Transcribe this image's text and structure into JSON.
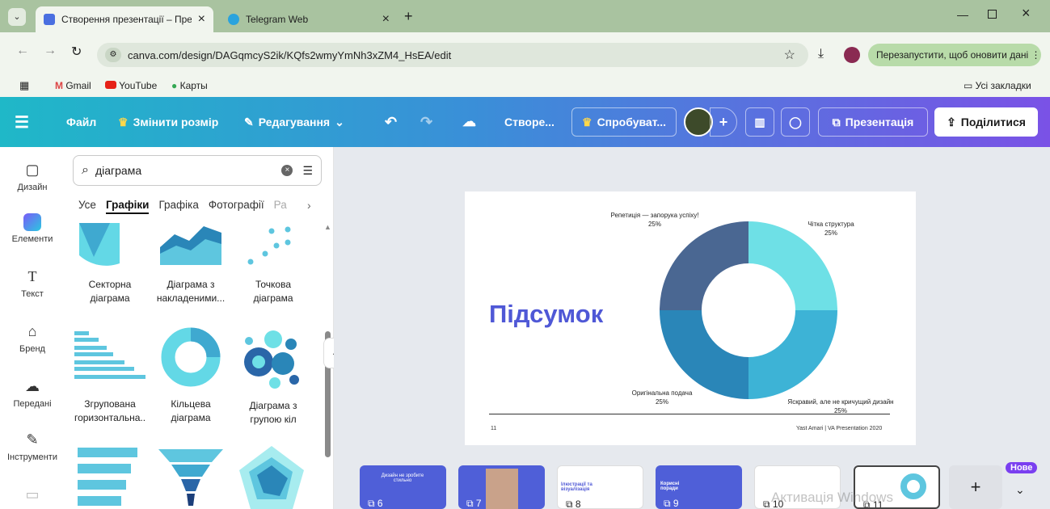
{
  "browser": {
    "tabs": [
      {
        "title": "Створення презентації – През",
        "close": "×"
      },
      {
        "title": "Telegram Web",
        "close": "×"
      }
    ],
    "new_tab": "+",
    "url": "canva.com/design/DAGqmcyS2ik/KQfs2wmyYmNh3xZM4_HsEA/edit",
    "update_button": "Перезапустити, щоб оновити дані",
    "bookmarks": [
      "Gmail",
      "YouTube",
      "Карты"
    ],
    "all_bookmarks": "Усі закладки"
  },
  "toolbar": {
    "file": "Файл",
    "resize": "Змінити розмір",
    "editing": "Редагування",
    "design_title": "Створе...",
    "try_pro": "Спробуват...",
    "present": "Презентація",
    "share": "Поділитися"
  },
  "rail": {
    "items": [
      "Дизайн",
      "Елементи",
      "Текст",
      "Бренд",
      "Передані",
      "Інструменти"
    ]
  },
  "panel": {
    "search_value": "діаграма",
    "categories": [
      "Усе",
      "Графіки",
      "Графіка",
      "Фотографії",
      "Ра"
    ],
    "items": [
      {
        "line1": "Секторна",
        "line2": "діаграма"
      },
      {
        "line1": "Діаграма з",
        "line2": "накладеними..."
      },
      {
        "line1": "Точкова",
        "line2": "діаграма"
      },
      {
        "line1": "Згрупована",
        "line2": "горизонтальна.."
      },
      {
        "line1": "Кільцева",
        "line2": "діаграма"
      },
      {
        "line1": "Діаграма з",
        "line2": "групою кіл"
      }
    ]
  },
  "slide": {
    "title": "Підсумок",
    "page_number": "11",
    "footer": "Yast Amari | VA Presentation 2020",
    "labels": [
      {
        "name": "Репетиція — запорука успіху!",
        "pct": "25%"
      },
      {
        "name": "Чітка структура",
        "pct": "25%"
      },
      {
        "name": "Оригінальна подача",
        "pct": "25%"
      },
      {
        "name": "Яскравий, але не кричущий дизайн",
        "pct": "25%"
      }
    ]
  },
  "chart_data": {
    "type": "pie",
    "categories": [
      "Чітка структура",
      "Яскравий, але не кричущий дизайн",
      "Оригінальна подача",
      "Репетиція — запорука успіху!"
    ],
    "values": [
      25,
      25,
      25,
      25
    ],
    "colors": [
      "#6ee0e6",
      "#3db3d6",
      "#2a86b8",
      "#4a6792"
    ]
  },
  "filmstrip": {
    "pages": [
      "6",
      "7",
      "8",
      "9",
      "10",
      "11"
    ],
    "thumb6_text": "Дизайн не зробите стильно",
    "thumb8_text": "Ілюстрації та візуалізація",
    "thumb9_text": "Корисні поради",
    "badge": "Нове",
    "add": "+",
    "watermark": "Активація Windows"
  }
}
